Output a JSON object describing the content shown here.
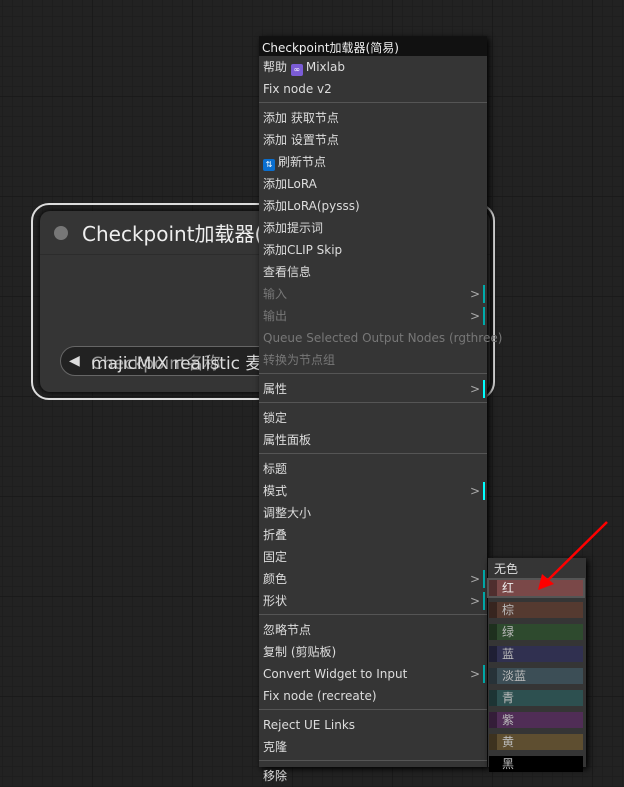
{
  "node": {
    "title": "Checkpoint加载器(简易)",
    "widget_label": "Checkpoint名称",
    "widget_value": "majicMIX realistic 麦橘写实"
  },
  "menu": {
    "title": "Checkpoint加载器(简易)",
    "items": [
      {
        "label": "帮助",
        "icon": "mixlab-infinity-icon",
        "suffix": "Mixlab"
      },
      {
        "label": "Fix node v2"
      },
      {
        "sep": true
      },
      {
        "label": "添加 获取节点"
      },
      {
        "label": "添加 设置节点"
      },
      {
        "label": "刷新节点",
        "icon": "refresh-icon"
      },
      {
        "label": "添加LoRA"
      },
      {
        "label": "添加LoRA(pysss)"
      },
      {
        "label": "添加提示词"
      },
      {
        "label": "添加CLIP Skip"
      },
      {
        "label": "查看信息"
      },
      {
        "label": "输入",
        "disabled": true,
        "submenu": true
      },
      {
        "label": "输出",
        "disabled": true,
        "submenu": true
      },
      {
        "label": "Queue Selected Output Nodes (rgthree)",
        "disabled": true
      },
      {
        "label": "转换为节点组",
        "disabled": true
      },
      {
        "sep": true
      },
      {
        "label": "属性",
        "submenu": true,
        "bright": true
      },
      {
        "sep": true
      },
      {
        "label": "锁定"
      },
      {
        "label": "属性面板"
      },
      {
        "sep": true
      },
      {
        "label": "标题"
      },
      {
        "label": "模式",
        "submenu": true,
        "bright": true
      },
      {
        "label": "调整大小"
      },
      {
        "label": "折叠"
      },
      {
        "label": "固定"
      },
      {
        "label": "颜色",
        "submenu": true
      },
      {
        "label": "形状",
        "submenu": true
      },
      {
        "sep": true
      },
      {
        "label": "忽略节点"
      },
      {
        "label": "复制 (剪贴板)"
      },
      {
        "label": "Convert Widget to Input",
        "submenu": true
      },
      {
        "label": "Fix node (recreate)"
      },
      {
        "sep": true
      },
      {
        "label": "Reject UE Links"
      },
      {
        "label": "克隆"
      },
      {
        "sep": true
      },
      {
        "label": "移除"
      }
    ]
  },
  "colors": {
    "none": "无色",
    "items": [
      {
        "label": "红",
        "color": "#7a4848",
        "highlight": true
      },
      {
        "label": "棕",
        "color": "#553a30"
      },
      {
        "label": "绿",
        "color": "#2e4a2e"
      },
      {
        "label": "蓝",
        "color": "#303050"
      },
      {
        "label": "淡蓝",
        "color": "#3c4e56"
      },
      {
        "label": "青",
        "color": "#2d5050"
      },
      {
        "label": "紫",
        "color": "#502d56"
      },
      {
        "label": "黄",
        "color": "#5e4e30"
      },
      {
        "label": "黑",
        "color": "#000000"
      }
    ]
  },
  "annotation": {
    "arrow_color": "#ff0000"
  }
}
